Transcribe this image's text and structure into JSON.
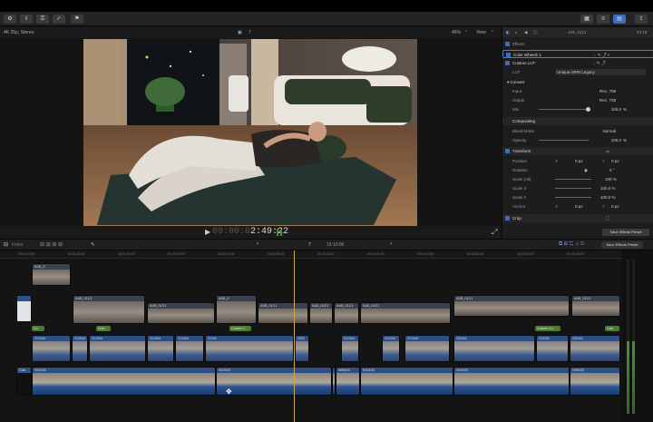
{
  "toolbar": {
    "left_icons": [
      "settings-icon",
      "download-icon",
      "key-icon",
      "check-icon",
      "flag-icon"
    ],
    "right_icons": [
      "grid-icon",
      "sliders-icon",
      "panel-icon",
      "share-icon"
    ]
  },
  "viewer": {
    "format": "4K 25p, Stereo",
    "clapper_value": "7",
    "zoom": "46%",
    "zoom_arrow": "⌃",
    "view_label": "View",
    "view_arrow": "⌃",
    "timecode_dim": "00:00:0",
    "timecode": "2:49:22"
  },
  "inspector": {
    "clip_name": "A45_0121",
    "duration": "23:18",
    "section_effects": "Effects",
    "effects": [
      {
        "name": "Color Wheels 1"
      },
      {
        "name": "Custom LUT"
      }
    ],
    "lut_label": "LUT",
    "lut_value": "Unique ARRI Legacy",
    "convert_label": "Convert",
    "input_label": "Input",
    "input_value": "Rec. 709",
    "output_label": "Output",
    "output_value": "Rec. 709",
    "mix_label": "Mix",
    "mix_value": "100,0",
    "mix_unit": "%",
    "mix_level": 1.0,
    "compositing_label": "Compositing",
    "blend_label": "Blend Mode",
    "blend_value": "Normal",
    "opacity_label": "Opacity",
    "opacity_value": "100,0",
    "opacity_unit": "%",
    "transform_label": "Transform",
    "position_label": "Position",
    "position_x_label": "X",
    "position_x": "0 px",
    "position_y_label": "Y",
    "position_y": "0 px",
    "rotation_label": "Rotation",
    "rotation_value": "0 °",
    "scale_all_label": "Scale (All)",
    "scale_all": "100 %",
    "scale_x_label": "Scale X",
    "scale_x": "100,0 %",
    "scale_y_label": "Scale Y",
    "scale_y": "100,0 %",
    "anchor_label": "Anchor",
    "anchor_x_label": "X",
    "anchor_x": "0 px",
    "anchor_y_label": "Y",
    "anchor_y": "0 px",
    "crop_label": "Crop",
    "save_preset": "Save Effects Preset"
  },
  "timeline": {
    "index_label": "Index",
    "project_counter": "7",
    "project_time": "15:10:00",
    "ruler_ticks": [
      "00:00:10:00",
      "00:01:00:00",
      "00:01:00:00",
      "00:02:00:00",
      "00:02:10:00",
      "00:03:00:00",
      "00:03:10:00",
      "00:04:00:00",
      "00:04:10:00",
      "00:05:00:00",
      "00:05:10:00",
      "00:06:00:00"
    ],
    "upper_clips": [
      "A45_0",
      "A45_0121",
      "A45_0121",
      "A45_0",
      "A45_0121",
      "A45_0121",
      "A45_0121",
      "A45_0121",
      "A45_0121",
      "A45_0121",
      "A45_0121"
    ],
    "gen_clips": [
      "Co..",
      "Colo..",
      "Custom C..",
      "Custom Co..",
      "Colo.."
    ],
    "blue_clips": [
      "G1944",
      "G1944",
      "G1944",
      "G1944",
      "G1944",
      "G194",
      "G39",
      "G1944",
      "G1944",
      "G1944",
      "G2041",
      "G2041",
      "G2041"
    ],
    "audio_clips": [
      "Cali..",
      "W1928",
      "W1928",
      "W1928",
      "W0925",
      "W1928",
      "W1928",
      "W0928"
    ]
  }
}
